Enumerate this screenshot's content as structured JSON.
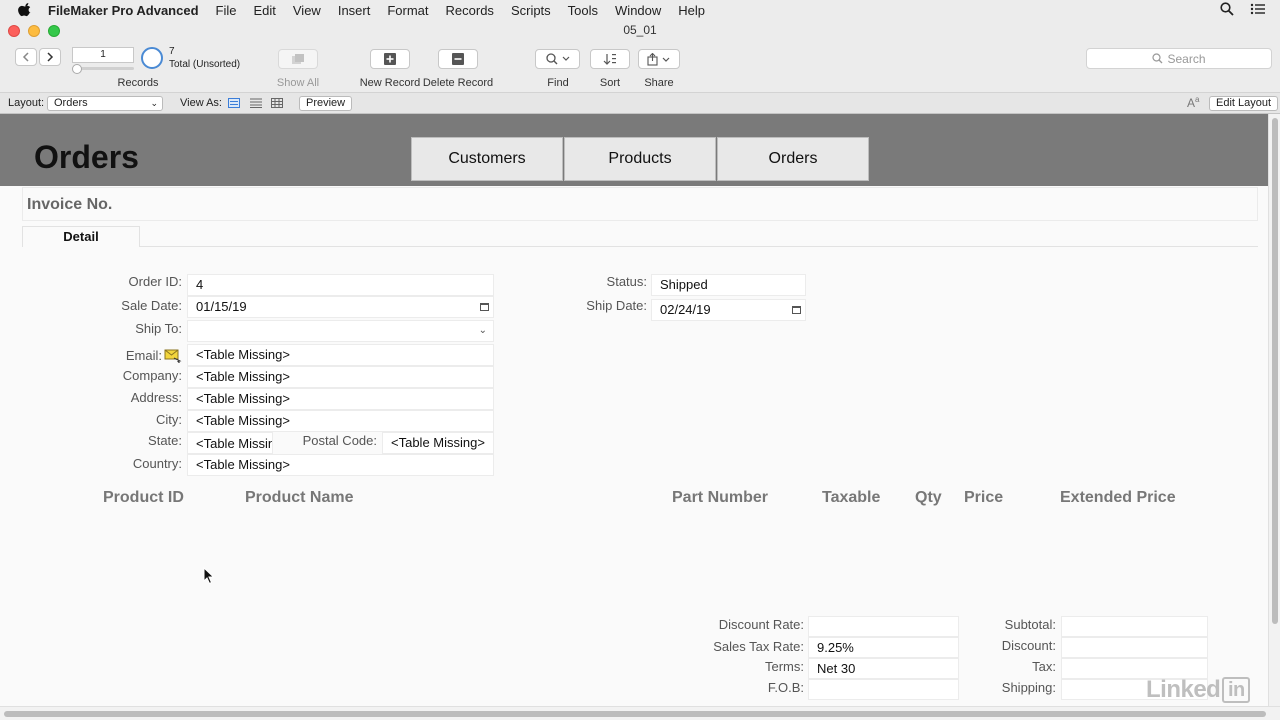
{
  "menubar": {
    "app_name": "FileMaker Pro Advanced",
    "items": [
      "File",
      "Edit",
      "View",
      "Insert",
      "Format",
      "Records",
      "Scripts",
      "Tools",
      "Window",
      "Help"
    ]
  },
  "window": {
    "title": "05_01"
  },
  "toolbar": {
    "record_number": "1",
    "found_count": "7",
    "found_status": "Total (Unsorted)",
    "records_label": "Records",
    "show_all_label": "Show All",
    "new_record_label": "New Record",
    "delete_record_label": "Delete Record",
    "find_label": "Find",
    "sort_label": "Sort",
    "share_label": "Share",
    "search_placeholder": "Search"
  },
  "layout_bar": {
    "layout_label": "Layout:",
    "layout_value": "Orders",
    "view_as_label": "View As:",
    "preview_label": "Preview",
    "edit_layout_label": "Edit Layout"
  },
  "header": {
    "title": "Orders",
    "nav_tabs": [
      "Customers",
      "Products",
      "Orders"
    ]
  },
  "invoice": {
    "label": "Invoice No."
  },
  "tabs": {
    "detail": "Detail"
  },
  "form": {
    "order_id_label": "Order ID:",
    "order_id": "4",
    "sale_date_label": "Sale Date:",
    "sale_date": "01/15/19",
    "ship_to_label": "Ship To:",
    "ship_to": "",
    "email_label": "Email:",
    "email": "<Table Missing>",
    "company_label": "Company:",
    "company": "<Table Missing>",
    "address_label": "Address:",
    "address": "<Table Missing>",
    "city_label": "City:",
    "city": "<Table Missing>",
    "state_label": "State:",
    "state": "<Table Missing>",
    "postal_code_label": "Postal Code:",
    "postal_code": "<Table Missing>",
    "country_label": "Country:",
    "country": "<Table Missing>",
    "status_label": "Status:",
    "status": "Shipped",
    "ship_date_label": "Ship Date:",
    "ship_date": "02/24/19"
  },
  "line_items": {
    "columns": [
      "Product ID",
      "Product Name",
      "Part Number",
      "Taxable",
      "Qty",
      "Price",
      "Extended Price"
    ]
  },
  "totals": {
    "discount_rate_label": "Discount Rate:",
    "discount_rate": "",
    "sales_tax_rate_label": "Sales Tax Rate:",
    "sales_tax_rate": "9.25%",
    "terms_label": "Terms:",
    "terms": "Net 30",
    "fob_label": "F.O.B:",
    "fob": "",
    "subtotal_label": "Subtotal:",
    "subtotal": "",
    "discount_label": "Discount:",
    "discount": "",
    "tax_label": "Tax:",
    "tax": "",
    "shipping_label": "Shipping:",
    "shipping": ""
  },
  "watermark": {
    "text": "Linked",
    "suffix": "in"
  }
}
